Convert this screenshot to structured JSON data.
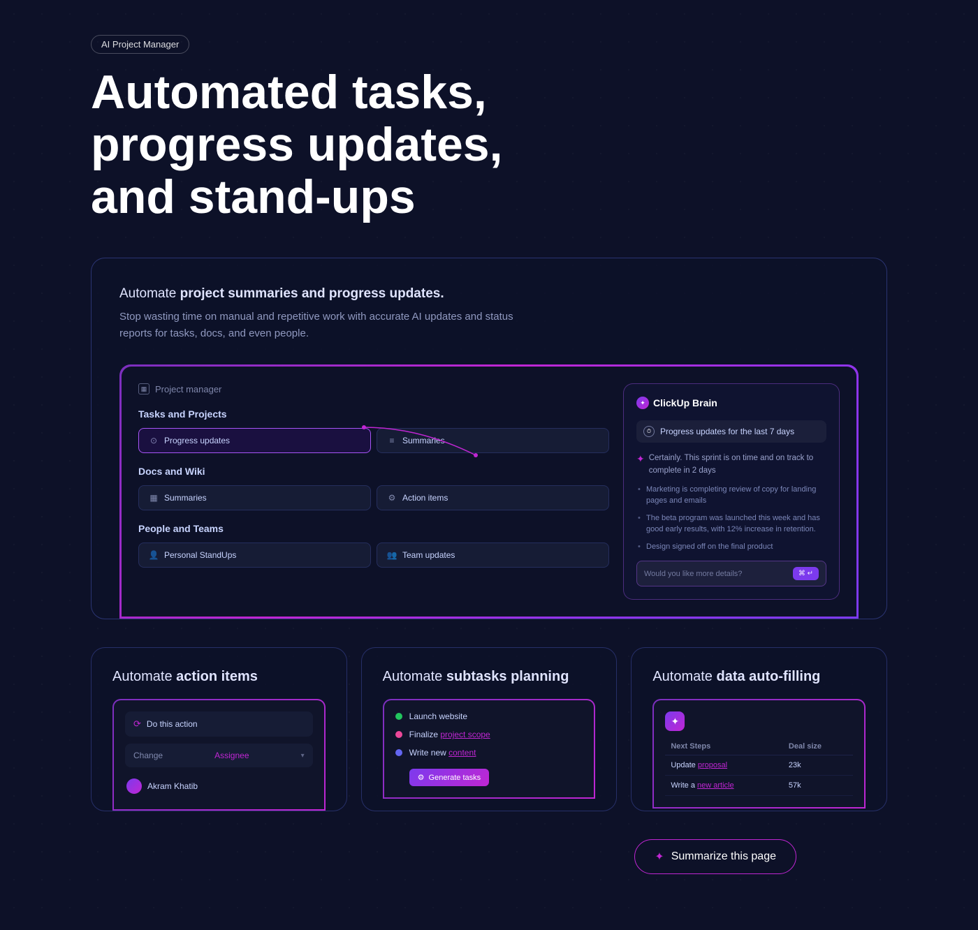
{
  "badge": {
    "label": "AI Project Manager"
  },
  "hero": {
    "title": "Automated tasks, progress updates, and stand-ups"
  },
  "main_card": {
    "heading_plain": "Automate ",
    "heading_bold": "project summaries and progress updates.",
    "description": "Stop wasting time on manual and repetitive work with accurate AI updates and status reports for tasks, docs, and even people.",
    "mockup": {
      "panel_header": "Project manager",
      "sections": [
        {
          "label": "Tasks and Projects",
          "buttons": [
            {
              "text": "Progress updates",
              "active": true
            },
            {
              "text": "Summaries",
              "active": false
            }
          ]
        },
        {
          "label": "Docs and Wiki",
          "buttons": [
            {
              "text": "Summaries",
              "active": false
            },
            {
              "text": "Action items",
              "active": false
            }
          ]
        },
        {
          "label": "People and Teams",
          "buttons": [
            {
              "text": "Personal StandUps",
              "active": false
            },
            {
              "text": "Team updates",
              "active": false
            }
          ]
        }
      ],
      "brain": {
        "title": "ClickUp Brain",
        "query": "Progress updates for the last 7 days",
        "intro": "Certainly. This sprint is on time and on track to complete in 2 days",
        "bullets": [
          "Marketing is completing review of copy for landing pages and emails",
          "The beta program was launched this week and has good early results, with 12% increase in retention.",
          "Design signed off on the final product"
        ],
        "input_placeholder": "Would you like more details?",
        "input_btn": "⌘ ↵"
      }
    }
  },
  "bottom_cards": [
    {
      "title_plain": "Automate ",
      "title_bold": "action items",
      "action_label": "Do this action",
      "dropdown_label": "Change",
      "dropdown_value": "Assignee",
      "user_name": "Akram Khatib"
    },
    {
      "title_plain": "Automate ",
      "title_bold": "subtasks planning",
      "subtasks": [
        {
          "text": "Launch website",
          "color": "#22c55e",
          "link": false
        },
        {
          "text": "Finalize ",
          "link_text": "project scope",
          "color": "#ec4899",
          "link": true
        },
        {
          "text": "Write new ",
          "link_text": "content",
          "color": "#6366f1",
          "link": true
        }
      ],
      "generate_btn": "Generate tasks"
    },
    {
      "title_plain": "Automate ",
      "title_bold": "data auto-filling",
      "table": {
        "headers": [
          "Next Steps",
          "Deal size"
        ],
        "rows": [
          {
            "col1": "Update ",
            "col1_link": "proposal",
            "col2": "23k"
          },
          {
            "col1": "Write a ",
            "col1_link": "new article",
            "col2": "57k"
          }
        ]
      }
    }
  ],
  "summarize_btn": "Summarize this page"
}
